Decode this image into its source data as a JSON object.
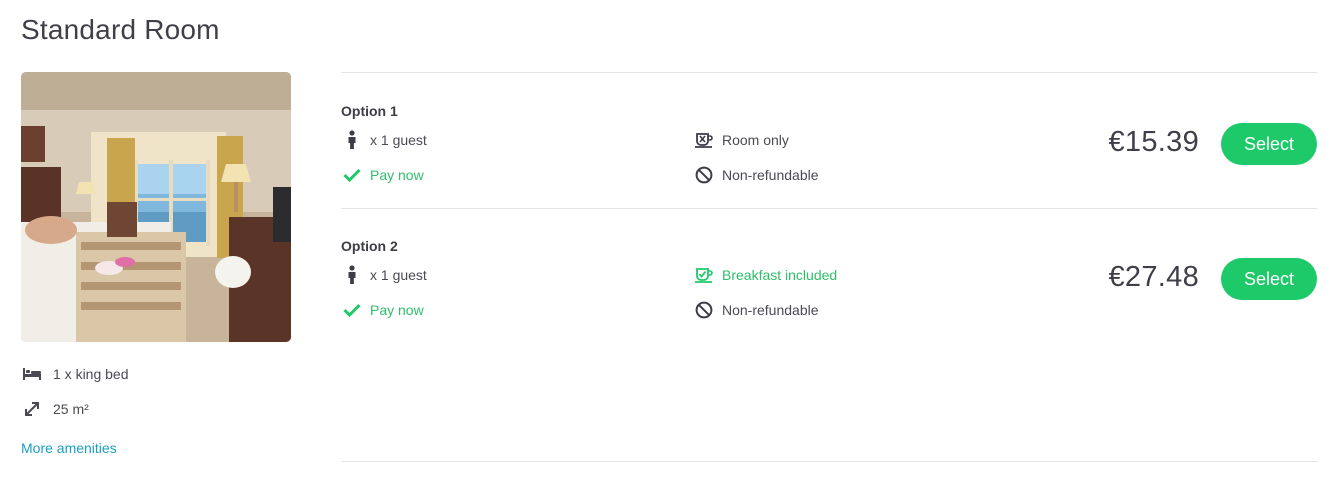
{
  "room": {
    "title": "Standard Room",
    "features": {
      "bed": "1 x king bed",
      "size": "25 m²"
    },
    "more_amenities": "More amenities"
  },
  "options": [
    {
      "label": "Option 1",
      "guests": "x 1 guest",
      "payment": "Pay now",
      "board": "Room only",
      "refund": "Non-refundable",
      "price": "€15.39",
      "select_label": "Select"
    },
    {
      "label": "Option 2",
      "guests": "x 1 guest",
      "payment": "Pay now",
      "board": "Breakfast included",
      "refund": "Non-refundable",
      "price": "€27.48",
      "select_label": "Select"
    }
  ],
  "icons": {
    "guest": "person-icon",
    "payment": "checkmark-icon",
    "room_only": "no-meal-icon",
    "breakfast": "breakfast-icon",
    "refund": "prohibited-icon",
    "bed": "bed-icon",
    "size": "resize-arrows-icon"
  },
  "colors": {
    "accent_green": "#1ec96a",
    "positive_text": "#2fbe6b",
    "link": "#1a9fc0",
    "text": "#3d3d47"
  }
}
